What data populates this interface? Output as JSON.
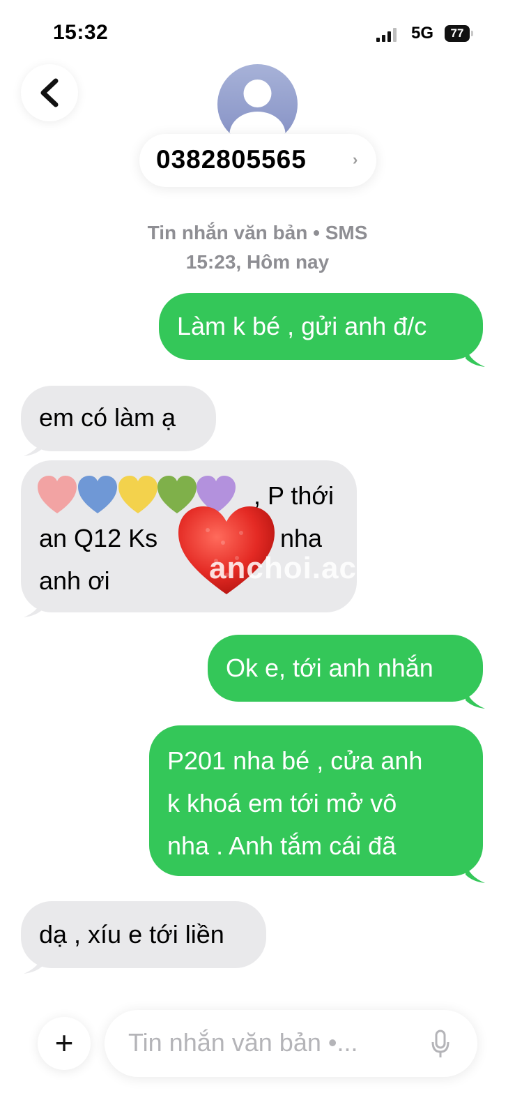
{
  "status_bar": {
    "time": "15:32",
    "network": "5G",
    "battery": "77"
  },
  "header": {
    "contact": "0382805565",
    "chevron": "›"
  },
  "thread_meta": {
    "channel": "Tin nhắn văn bản • SMS",
    "timestamp": "15:23, Hôm nay"
  },
  "messages": [
    {
      "direction": "out",
      "lines": [
        "Làm k bé , gửi anh đ/c"
      ]
    },
    {
      "direction": "in",
      "lines": [
        "em có làm ạ"
      ]
    },
    {
      "direction": "in",
      "lines": [
        ", P thới",
        "an Q12 Ks",
        "nha",
        "anh ơi"
      ]
    },
    {
      "direction": "out",
      "lines": [
        "Ok e, tới anh nhắn"
      ]
    },
    {
      "direction": "out",
      "lines": [
        "P201 nha bé , cửa anh",
        "k khoá em tới mở vô",
        "nha . Anh tắm cái đã"
      ]
    },
    {
      "direction": "in",
      "lines": [
        "dạ , xíu e tới liền"
      ]
    }
  ],
  "redaction_hearts": [
    "#f2a3a3",
    "#6f98d6",
    "#f3d24c",
    "#7fb04a",
    "#b391dd"
  ],
  "watermark": "anchoi.ac",
  "composer": {
    "placeholder": "Tin nhắn văn bản •...",
    "plus": "+"
  },
  "colors": {
    "outgoing": "#34c759",
    "incoming": "#e9e9eb",
    "meta": "#8e8e93"
  }
}
